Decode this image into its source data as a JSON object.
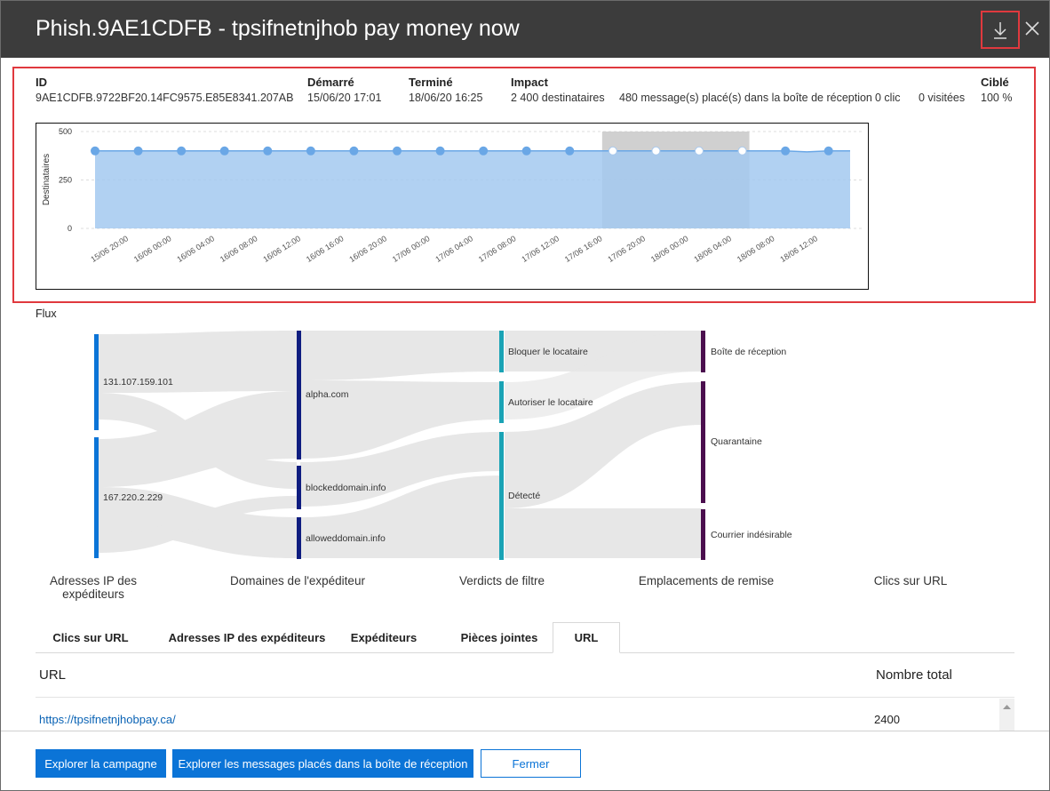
{
  "title": "Phish.9AE1CDFB - tpsifnetnjhob pay money now",
  "summary": {
    "id_label": "ID",
    "id_value": "9AE1CDFB.9722BF20.14FC9575.E85E8341.207AB",
    "started_label": "Démarré",
    "started_value": "15/06/20 17:01",
    "ended_label": "Terminé",
    "ended_value": "18/06/20 16:25",
    "impact_label": "Impact",
    "impact_recipients": "2 400 destinataires",
    "impact_inbox": "480 message(s) placé(s) dans la boîte de réception",
    "impact_clicks": "0 clic",
    "impact_visits": "0 visitées",
    "targeted_label": "Ciblé",
    "targeted_value": "100 %"
  },
  "chart_data": {
    "type": "area",
    "ylabel": "Destinataires",
    "ylim": [
      0,
      500
    ],
    "yticks": [
      "500",
      "250",
      "0"
    ],
    "xticks": [
      "15/06 20:00",
      "16/06 00:00",
      "16/06 04:00",
      "16/06 08:00",
      "16/06 12:00",
      "16/06 16:00",
      "16/06 20:00",
      "17/06 00:00",
      "17/06 04:00",
      "17/06 08:00",
      "17/06 12:00",
      "17/06 16:00",
      "17/06 20:00",
      "18/06 00:00",
      "18/06 04:00",
      "18/06 08:00",
      "18/06 12:00"
    ],
    "values": [
      400,
      400,
      400,
      400,
      400,
      400,
      400,
      400,
      400,
      400,
      400,
      400,
      400,
      400,
      400,
      400,
      400,
      400,
      400,
      400,
      400,
      400,
      400,
      400,
      400,
      400,
      400,
      400,
      400,
      400,
      400,
      400,
      400,
      395,
      400,
      400
    ],
    "highlight": {
      "from_index": 24,
      "to_index": 30
    },
    "grid": true,
    "colors": {
      "area": "#a3c9f0",
      "line": "#6aa7e6",
      "highlight": "#c8c8c8"
    }
  },
  "flow": {
    "label": "Flux",
    "columns": [
      "Adresses IP des expéditeurs",
      "Domaines de l'expéditeur",
      "Verdicts de filtre",
      "Emplacements de remise",
      "Clics sur URL"
    ],
    "nodes": {
      "ip1": "131.107.159.101",
      "ip2": "167.220.2.229",
      "d1": "alpha.com",
      "d2": "blockeddomain.info",
      "d3": "alloweddomain.info",
      "v1": "Bloquer le locataire",
      "v2": "Autoriser le locataire",
      "v3": "Détecté",
      "e1": "Boîte de réception",
      "e2": "Quarantaine",
      "e3": "Courrier indésirable"
    },
    "colors": {
      "ip": "#0b74d7",
      "domain": "#0f1d80",
      "verdict": "#1aa3b5",
      "location": "#4b0e4e",
      "link": "#e6e6e6"
    }
  },
  "tabs": [
    {
      "label": "Clics sur URL",
      "active": false
    },
    {
      "label": "Adresses IP des expéditeurs",
      "active": false
    },
    {
      "label": "Expéditeurs",
      "active": false
    },
    {
      "label": "Pièces jointes",
      "active": false
    },
    {
      "label": "URL",
      "active": true
    }
  ],
  "table": {
    "headers": [
      "URL",
      "Nombre total"
    ],
    "rows": [
      {
        "url": "https://tpsifnetnjhobpay.ca/",
        "total": "2400"
      }
    ]
  },
  "footer": {
    "explore_campaign": "Explorer la campagne",
    "explore_inbox": "Explorer les messages placés dans la boîte de réception",
    "close": "Fermer"
  }
}
